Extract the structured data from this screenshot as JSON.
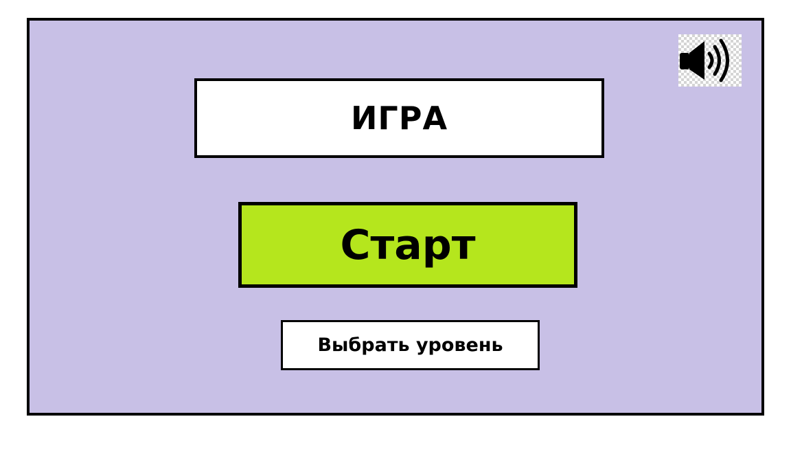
{
  "screen": {
    "background_color": "#c8c0e6",
    "sound_icon": "speaker-volume-icon",
    "title": "ИГРА",
    "start_button": {
      "label": "Старт",
      "color": "#b5e61d"
    },
    "level_button": {
      "label": "Выбрать уровень"
    }
  }
}
